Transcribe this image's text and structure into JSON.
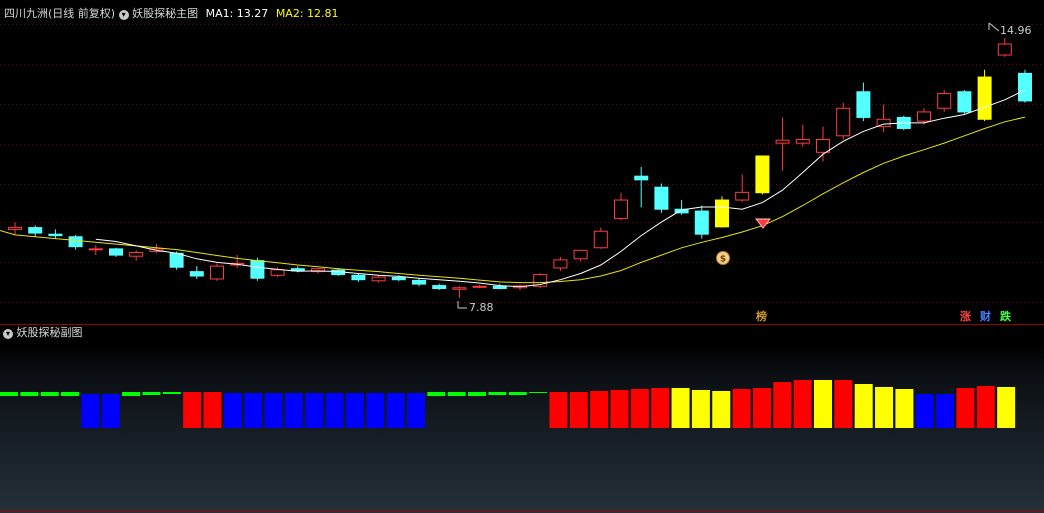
{
  "main_header": {
    "stock_title": "四川九洲(日线 前复权)",
    "indicator_name": "妖股探秘主图",
    "ma1_label": "MA1: 13.27",
    "ma2_label": "MA2: 12.81"
  },
  "sub_header": {
    "indicator_name": "妖股探秘副图"
  },
  "price_annotations": {
    "high": "14.96",
    "low": "7.88"
  },
  "signals": {
    "top": "榜",
    "up": "涨",
    "money": "财",
    "down": "跌"
  },
  "colors": {
    "background": "#000000",
    "grid": "#7a0000",
    "candle_up": "#ff3c3c",
    "candle_down": "#54ffff",
    "candle_special": "#ffff00",
    "ma1": "#ffffff",
    "ma2": "#ffff00",
    "bar_green": "#00ff00",
    "bar_blue": "#0000ff",
    "bar_red": "#ff0000",
    "bar_yellow": "#ffff00"
  },
  "chart_data": [
    {
      "type": "candlestick",
      "title": "妖股探秘主图",
      "ylim": [
        7.5,
        15.4
      ],
      "series": [
        {
          "o": 9.75,
          "h": 9.95,
          "l": 9.6,
          "c": 9.8,
          "color": "up"
        },
        {
          "o": 9.8,
          "h": 9.86,
          "l": 9.55,
          "c": 9.65,
          "color": "down"
        },
        {
          "o": 9.62,
          "h": 9.75,
          "l": 9.5,
          "c": 9.58,
          "color": "down"
        },
        {
          "o": 9.55,
          "h": 9.6,
          "l": 9.2,
          "c": 9.28,
          "color": "down"
        },
        {
          "o": 9.2,
          "h": 9.32,
          "l": 9.05,
          "c": 9.22,
          "color": "up"
        },
        {
          "o": 9.22,
          "h": 9.25,
          "l": 9.0,
          "c": 9.05,
          "color": "down"
        },
        {
          "o": 9.02,
          "h": 9.18,
          "l": 8.9,
          "c": 9.12,
          "color": "up"
        },
        {
          "o": 9.15,
          "h": 9.35,
          "l": 9.1,
          "c": 9.22,
          "color": "up"
        },
        {
          "o": 9.1,
          "h": 9.15,
          "l": 8.65,
          "c": 8.72,
          "color": "down"
        },
        {
          "o": 8.6,
          "h": 8.75,
          "l": 8.4,
          "c": 8.48,
          "color": "down"
        },
        {
          "o": 8.4,
          "h": 8.82,
          "l": 8.35,
          "c": 8.75,
          "color": "up"
        },
        {
          "o": 8.78,
          "h": 9.05,
          "l": 8.7,
          "c": 8.82,
          "color": "up"
        },
        {
          "o": 8.9,
          "h": 8.98,
          "l": 8.35,
          "c": 8.42,
          "color": "down"
        },
        {
          "o": 8.5,
          "h": 8.72,
          "l": 8.45,
          "c": 8.65,
          "color": "up"
        },
        {
          "o": 8.68,
          "h": 8.75,
          "l": 8.58,
          "c": 8.62,
          "color": "down"
        },
        {
          "o": 8.6,
          "h": 8.7,
          "l": 8.55,
          "c": 8.68,
          "color": "up"
        },
        {
          "o": 8.64,
          "h": 8.7,
          "l": 8.48,
          "c": 8.52,
          "color": "down"
        },
        {
          "o": 8.5,
          "h": 8.56,
          "l": 8.32,
          "c": 8.38,
          "color": "down"
        },
        {
          "o": 8.35,
          "h": 8.5,
          "l": 8.3,
          "c": 8.45,
          "color": "up"
        },
        {
          "o": 8.44,
          "h": 8.5,
          "l": 8.34,
          "c": 8.38,
          "color": "down"
        },
        {
          "o": 8.36,
          "h": 8.42,
          "l": 8.2,
          "c": 8.26,
          "color": "down"
        },
        {
          "o": 8.22,
          "h": 8.27,
          "l": 8.1,
          "c": 8.14,
          "color": "down"
        },
        {
          "o": 8.12,
          "h": 8.2,
          "l": 7.88,
          "c": 8.16,
          "color": "up"
        },
        {
          "o": 8.18,
          "h": 8.24,
          "l": 8.15,
          "c": 8.2,
          "color": "up"
        },
        {
          "o": 8.2,
          "h": 8.27,
          "l": 8.12,
          "c": 8.14,
          "color": "down"
        },
        {
          "o": 8.16,
          "h": 8.25,
          "l": 8.1,
          "c": 8.21,
          "color": "up"
        },
        {
          "o": 8.2,
          "h": 8.56,
          "l": 8.15,
          "c": 8.52,
          "color": "up"
        },
        {
          "o": 8.7,
          "h": 9.0,
          "l": 8.62,
          "c": 8.92,
          "color": "up"
        },
        {
          "o": 8.95,
          "h": 9.2,
          "l": 8.88,
          "c": 9.18,
          "color": "up"
        },
        {
          "o": 9.25,
          "h": 9.8,
          "l": 9.22,
          "c": 9.7,
          "color": "up"
        },
        {
          "o": 10.05,
          "h": 10.75,
          "l": 10.0,
          "c": 10.55,
          "color": "up"
        },
        {
          "o": 11.2,
          "h": 11.45,
          "l": 10.35,
          "c": 11.1,
          "color": "down"
        },
        {
          "o": 10.9,
          "h": 11.0,
          "l": 10.2,
          "c": 10.3,
          "color": "down"
        },
        {
          "o": 10.3,
          "h": 10.55,
          "l": 10.15,
          "c": 10.2,
          "color": "down"
        },
        {
          "o": 10.25,
          "h": 10.4,
          "l": 9.5,
          "c": 9.62,
          "color": "down"
        },
        {
          "o": 9.82,
          "h": 10.65,
          "l": 9.8,
          "c": 10.55,
          "color": "special"
        },
        {
          "o": 10.55,
          "h": 11.25,
          "l": 10.5,
          "c": 10.76,
          "color": "up"
        },
        {
          "o": 10.75,
          "h": 11.45,
          "l": 10.7,
          "c": 11.75,
          "color": "special"
        },
        {
          "o": 12.1,
          "h": 12.8,
          "l": 11.35,
          "c": 12.18,
          "color": "up"
        },
        {
          "o": 12.2,
          "h": 12.6,
          "l": 12.0,
          "c": 12.1,
          "color": "up"
        },
        {
          "o": 11.85,
          "h": 12.55,
          "l": 11.6,
          "c": 12.2,
          "color": "up"
        },
        {
          "o": 12.3,
          "h": 13.2,
          "l": 12.2,
          "c": 13.05,
          "color": "up"
        },
        {
          "o": 13.5,
          "h": 13.75,
          "l": 12.7,
          "c": 12.8,
          "color": "down"
        },
        {
          "o": 12.55,
          "h": 13.15,
          "l": 12.4,
          "c": 12.75,
          "color": "up"
        },
        {
          "o": 12.8,
          "h": 12.85,
          "l": 12.45,
          "c": 12.5,
          "color": "down"
        },
        {
          "o": 12.7,
          "h": 13.05,
          "l": 12.6,
          "c": 12.95,
          "color": "up"
        },
        {
          "o": 13.05,
          "h": 13.55,
          "l": 12.95,
          "c": 13.45,
          "color": "up"
        },
        {
          "o": 13.5,
          "h": 13.55,
          "l": 12.9,
          "c": 12.95,
          "color": "down"
        },
        {
          "o": 12.75,
          "h": 14.1,
          "l": 12.7,
          "c": 13.9,
          "color": "special"
        },
        {
          "o": 14.5,
          "h": 14.96,
          "l": 14.45,
          "c": 14.8,
          "color": "up"
        },
        {
          "o": 14.0,
          "h": 14.1,
          "l": 13.2,
          "c": 13.25,
          "color": "down"
        }
      ],
      "ma1": [
        null,
        null,
        null,
        null,
        9.48,
        9.42,
        9.3,
        9.18,
        9.1,
        8.95,
        8.85,
        8.8,
        8.72,
        8.66,
        8.61,
        8.62,
        8.6,
        8.55,
        8.5,
        8.47,
        8.42,
        8.38,
        8.34,
        8.29,
        8.22,
        8.19,
        8.25,
        8.38,
        8.55,
        8.78,
        9.15,
        9.58,
        9.95,
        10.28,
        10.36,
        10.36,
        10.3,
        10.48,
        10.82,
        11.3,
        11.8,
        12.15,
        12.42,
        12.62,
        12.65,
        12.65,
        12.78,
        12.88,
        13.08,
        13.28,
        13.55
      ],
      "ma2": [
        9.6,
        9.55,
        9.5,
        9.45,
        9.4,
        9.35,
        9.3,
        9.25,
        9.2,
        9.12,
        9.04,
        8.96,
        8.9,
        8.84,
        8.78,
        8.73,
        8.68,
        8.64,
        8.6,
        8.55,
        8.5,
        8.46,
        8.42,
        8.37,
        8.32,
        8.3,
        8.3,
        8.33,
        8.38,
        8.48,
        8.63,
        8.85,
        9.05,
        9.25,
        9.4,
        9.53,
        9.68,
        9.85,
        10.1,
        10.4,
        10.72,
        11.02,
        11.3,
        11.55,
        11.75,
        11.92,
        12.1,
        12.3,
        12.5,
        12.68,
        12.81
      ]
    },
    {
      "type": "bar",
      "title": "妖股探秘副图",
      "ylim": [
        0,
        100
      ],
      "series": [
        {
          "b": 32,
          "t": 36,
          "color": "green"
        },
        {
          "b": 32,
          "t": 36,
          "color": "green"
        },
        {
          "b": 32,
          "t": 36,
          "color": "green"
        },
        {
          "b": 32,
          "t": 36,
          "color": "green"
        },
        {
          "b": 0,
          "t": 34,
          "color": "blue"
        },
        {
          "b": 0,
          "t": 34,
          "color": "blue"
        },
        {
          "b": 32,
          "t": 36,
          "color": "green"
        },
        {
          "b": 33,
          "t": 36,
          "color": "green"
        },
        {
          "b": 34,
          "t": 36,
          "color": "green"
        },
        {
          "b": 0,
          "t": 36,
          "color": "red"
        },
        {
          "b": 0,
          "t": 36,
          "color": "red"
        },
        {
          "b": 0,
          "t": 35,
          "color": "blue"
        },
        {
          "b": 0,
          "t": 35,
          "color": "blue"
        },
        {
          "b": 0,
          "t": 35,
          "color": "blue"
        },
        {
          "b": 0,
          "t": 35,
          "color": "blue"
        },
        {
          "b": 0,
          "t": 35,
          "color": "blue"
        },
        {
          "b": 0,
          "t": 35,
          "color": "blue"
        },
        {
          "b": 0,
          "t": 35,
          "color": "blue"
        },
        {
          "b": 0,
          "t": 35,
          "color": "blue"
        },
        {
          "b": 0,
          "t": 35,
          "color": "blue"
        },
        {
          "b": 0,
          "t": 35,
          "color": "blue"
        },
        {
          "b": 32,
          "t": 36,
          "color": "green"
        },
        {
          "b": 32,
          "t": 36,
          "color": "green"
        },
        {
          "b": 32,
          "t": 36,
          "color": "green"
        },
        {
          "b": 33,
          "t": 36,
          "color": "green"
        },
        {
          "b": 33,
          "t": 36,
          "color": "green"
        },
        {
          "b": 35,
          "t": 36,
          "color": "green"
        },
        {
          "b": 0,
          "t": 36,
          "color": "red"
        },
        {
          "b": 0,
          "t": 36,
          "color": "red"
        },
        {
          "b": 0,
          "t": 37,
          "color": "red"
        },
        {
          "b": 0,
          "t": 38,
          "color": "red"
        },
        {
          "b": 0,
          "t": 39,
          "color": "red"
        },
        {
          "b": 0,
          "t": 40,
          "color": "red"
        },
        {
          "b": 0,
          "t": 40,
          "color": "yellow"
        },
        {
          "b": 0,
          "t": 38,
          "color": "yellow"
        },
        {
          "b": 0,
          "t": 37,
          "color": "yellow"
        },
        {
          "b": 0,
          "t": 39,
          "color": "red"
        },
        {
          "b": 0,
          "t": 40,
          "color": "red"
        },
        {
          "b": 0,
          "t": 46,
          "color": "red"
        },
        {
          "b": 0,
          "t": 48,
          "color": "red"
        },
        {
          "b": 0,
          "t": 48,
          "color": "yellow"
        },
        {
          "b": 0,
          "t": 48,
          "color": "red"
        },
        {
          "b": 0,
          "t": 44,
          "color": "yellow"
        },
        {
          "b": 0,
          "t": 41,
          "color": "yellow"
        },
        {
          "b": 0,
          "t": 39,
          "color": "yellow"
        },
        {
          "b": 0,
          "t": 34,
          "color": "blue"
        },
        {
          "b": 0,
          "t": 34,
          "color": "blue"
        },
        {
          "b": 0,
          "t": 40,
          "color": "red"
        },
        {
          "b": 0,
          "t": 42,
          "color": "red"
        },
        {
          "b": 0,
          "t": 41,
          "color": "yellow"
        }
      ]
    }
  ]
}
